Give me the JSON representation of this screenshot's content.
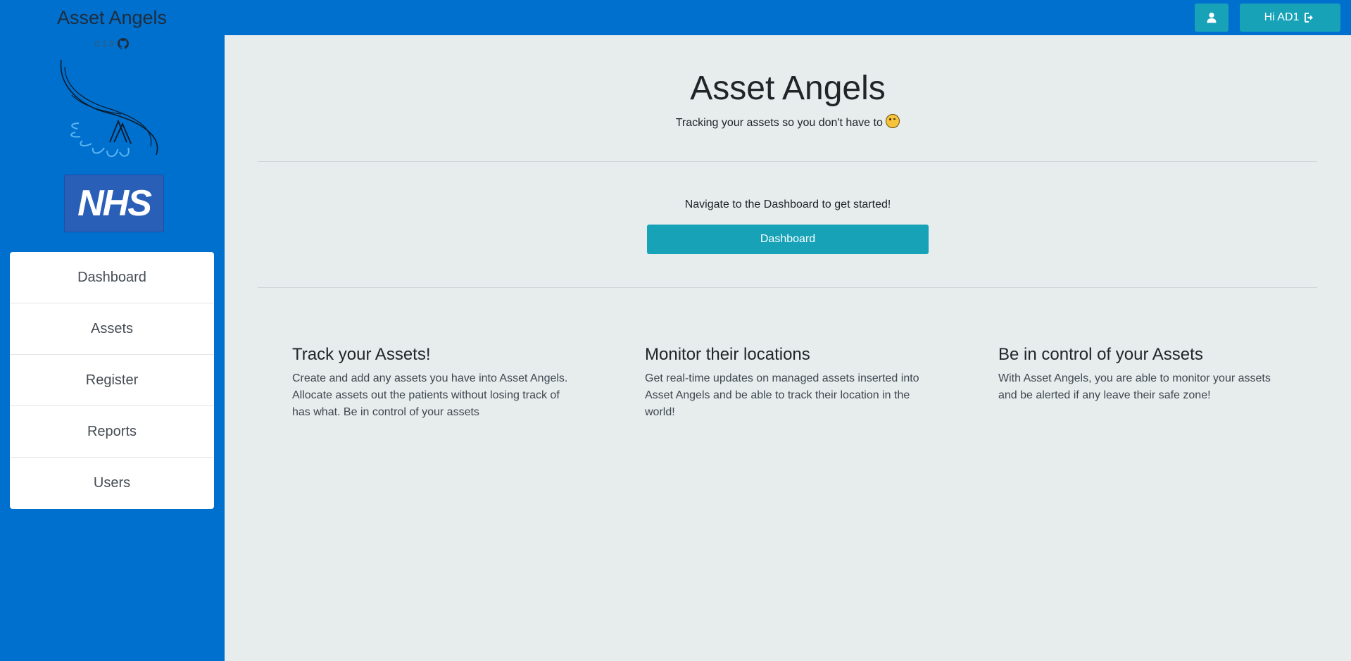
{
  "app": {
    "title": "Asset Angels",
    "version": "0.1.3"
  },
  "colors": {
    "primary": "#0070cf",
    "teal": "#17a2b8",
    "main_bg": "#e7eced"
  },
  "header": {
    "profile_icon": "user-icon",
    "logout_label": "Hi AD1",
    "logout_icon": "sign-out-icon"
  },
  "sidebar": {
    "github_icon": "github-icon",
    "items": [
      {
        "label": "Dashboard"
      },
      {
        "label": "Assets"
      },
      {
        "label": "Register"
      },
      {
        "label": "Reports"
      },
      {
        "label": "Users"
      }
    ]
  },
  "main": {
    "title": "Asset Angels",
    "subtitle": "Tracking your assets so you don't have to",
    "cta_text": "Navigate to the Dashboard to get started!",
    "cta_button": "Dashboard",
    "features": [
      {
        "title": "Track your Assets!",
        "text": "Create and add any assets you have into Asset Angels. Allocate assets out the patients without losing track of has what. Be in control of your assets"
      },
      {
        "title": "Monitor their locations",
        "text": "Get real-time updates on managed assets inserted into Asset Angels and be able to track their location in the world!"
      },
      {
        "title": "Be in control of your Assets",
        "text": "With Asset Angels, you are able to monitor your assets and be alerted if any leave their safe zone!"
      }
    ]
  }
}
